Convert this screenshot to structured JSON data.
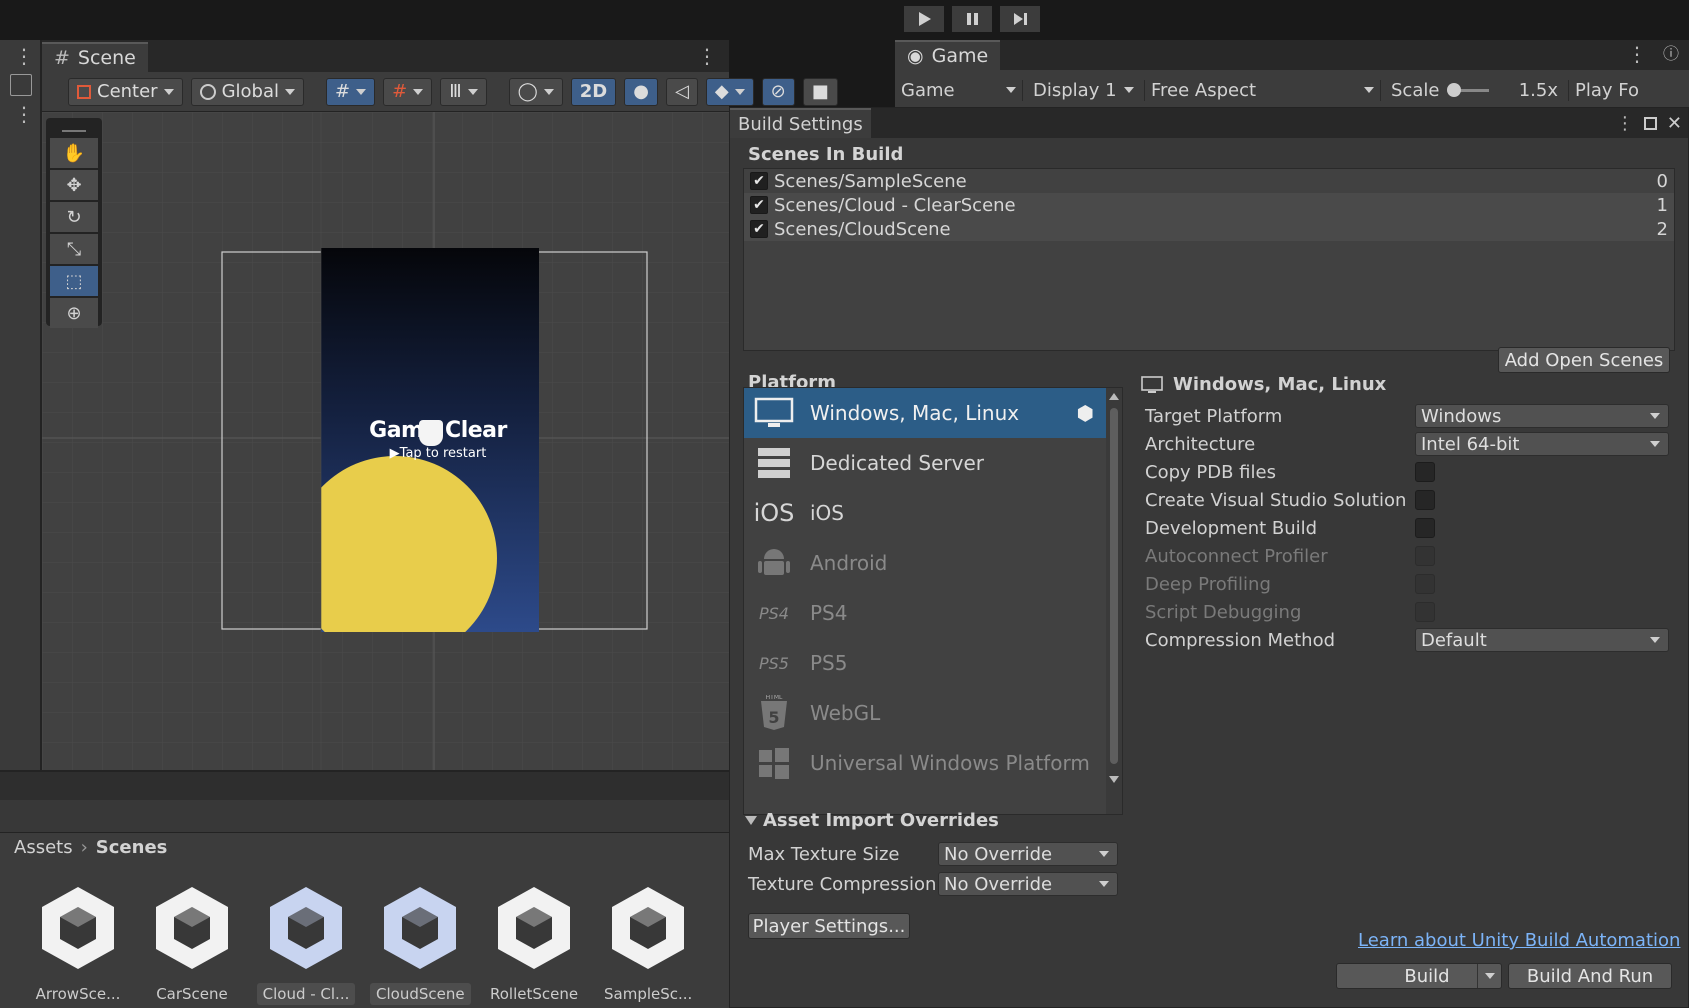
{
  "colors": {
    "accent": "#2c5d87",
    "link": "#7cb4f8",
    "panel": "#383838",
    "dark": "#191919",
    "sun": "#e8cd4b"
  },
  "scene": {
    "tab_label": "Scene",
    "pivot_label": "Center",
    "space_label": "Global",
    "mode_2d": "2D",
    "game_title": "Game Clear",
    "game_subtitle": "Tap to restart"
  },
  "game": {
    "tab_label": "Game",
    "view_select": "Game",
    "display_select": "Display 1",
    "aspect_select": "Free Aspect",
    "scale_label": "Scale",
    "scale_value": "1.5x",
    "play_label": "Play Fo"
  },
  "build": {
    "title": "Build Settings",
    "scenes_header": "Scenes In Build",
    "scenes": [
      {
        "name": "Scenes/SampleScene",
        "index": "0",
        "checked": "✔"
      },
      {
        "name": "Scenes/Cloud - ClearScene",
        "index": "1",
        "checked": "✔"
      },
      {
        "name": "Scenes/CloudScene",
        "index": "2",
        "checked": "✔"
      }
    ],
    "add_open_scenes": "Add Open Scenes",
    "platform_header": "Platform",
    "platforms": [
      {
        "name": "Windows, Mac, Linux",
        "icon": "monitor-icon"
      },
      {
        "name": "Dedicated Server",
        "icon": "server-icon"
      },
      {
        "name": "iOS",
        "icon": "ios-icon",
        "icon_text": "iOS"
      },
      {
        "name": "Android",
        "icon": "android-icon"
      },
      {
        "name": "PS4",
        "icon": "ps4-icon",
        "icon_text": "PS4"
      },
      {
        "name": "PS5",
        "icon": "ps5-icon",
        "icon_text": "PS5"
      },
      {
        "name": "WebGL",
        "icon": "html5-icon"
      },
      {
        "name": "Universal Windows Platform",
        "icon": "windows-logo-icon"
      }
    ],
    "selected_platform_title": "Windows, Mac, Linux",
    "target_platform_label": "Target Platform",
    "target_platform_value": "Windows",
    "architecture_label": "Architecture",
    "architecture_value": "Intel 64-bit",
    "copy_pdb_label": "Copy PDB files",
    "create_vs_label": "Create Visual Studio Solution",
    "dev_build_label": "Development Build",
    "autoconnect_label": "Autoconnect Profiler",
    "deep_profiling_label": "Deep Profiling",
    "script_debugging_label": "Script Debugging",
    "compression_label": "Compression Method",
    "compression_value": "Default",
    "asset_import_header": "Asset Import Overrides",
    "max_texture_label": "Max Texture Size",
    "max_texture_value": "No Override",
    "texture_compression_label": "Texture Compression",
    "texture_compression_value": "No Override",
    "player_settings": "Player Settings...",
    "learn_link": "Learn about Unity Build Automation",
    "build_button": "Build",
    "build_and_run": "Build And Run"
  },
  "project": {
    "breadcrumb_root": "Assets",
    "breadcrumb_current": "Scenes",
    "assets": [
      {
        "label": "ArrowSce...",
        "selected": false
      },
      {
        "label": "CarScene",
        "selected": false
      },
      {
        "label": "Cloud - Cl...",
        "selected": true
      },
      {
        "label": "CloudScene",
        "selected": true
      },
      {
        "label": "RolletScene",
        "selected": false
      },
      {
        "label": "SampleSc...",
        "selected": false
      }
    ]
  }
}
